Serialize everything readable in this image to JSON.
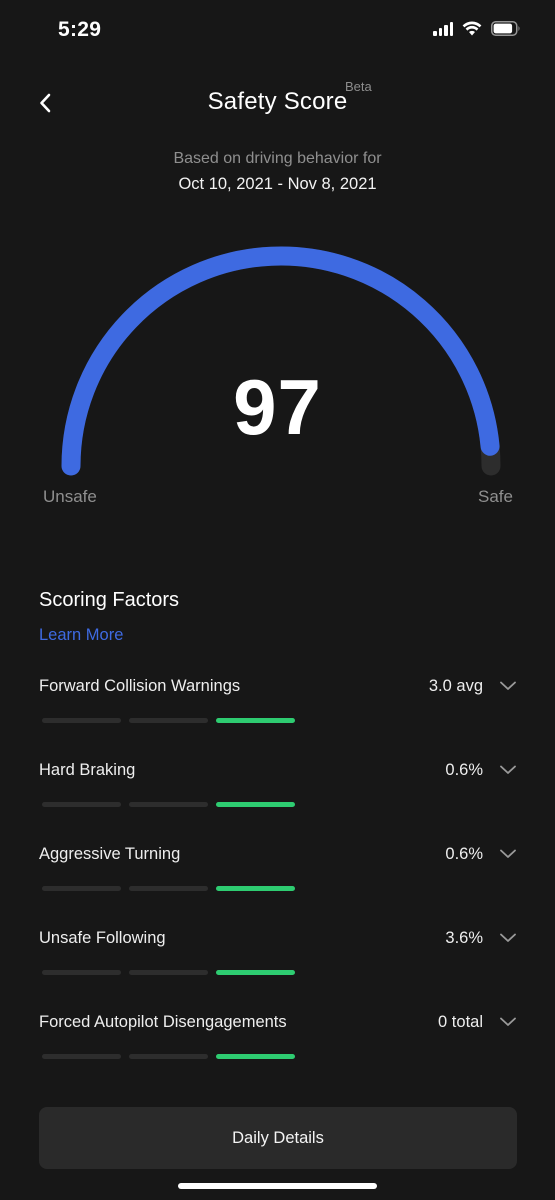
{
  "status_bar": {
    "time": "5:29"
  },
  "header": {
    "title": "Safety Score",
    "badge": "Beta"
  },
  "period": {
    "subtitle": "Based on driving behavior for",
    "range": "Oct 10, 2021 - Nov 8, 2021"
  },
  "gauge": {
    "score": "97",
    "score_value": 97,
    "min_label": "Unsafe",
    "max_label": "Safe",
    "color": "#3e6ae1",
    "track_color": "#2d2d2d"
  },
  "factors": {
    "title": "Scoring Factors",
    "learn_more": "Learn More",
    "bar_active_color": "#2ecc71",
    "items": [
      {
        "label": "Forward Collision Warnings",
        "value": "3.0 avg",
        "level": 3
      },
      {
        "label": "Hard Braking",
        "value": "0.6%",
        "level": 3
      },
      {
        "label": "Aggressive Turning",
        "value": "0.6%",
        "level": 3
      },
      {
        "label": "Unsafe Following",
        "value": "3.6%",
        "level": 3
      },
      {
        "label": "Forced Autopilot Disengagements",
        "value": "0 total",
        "level": 3
      }
    ]
  },
  "footer": {
    "daily_details": "Daily Details"
  }
}
